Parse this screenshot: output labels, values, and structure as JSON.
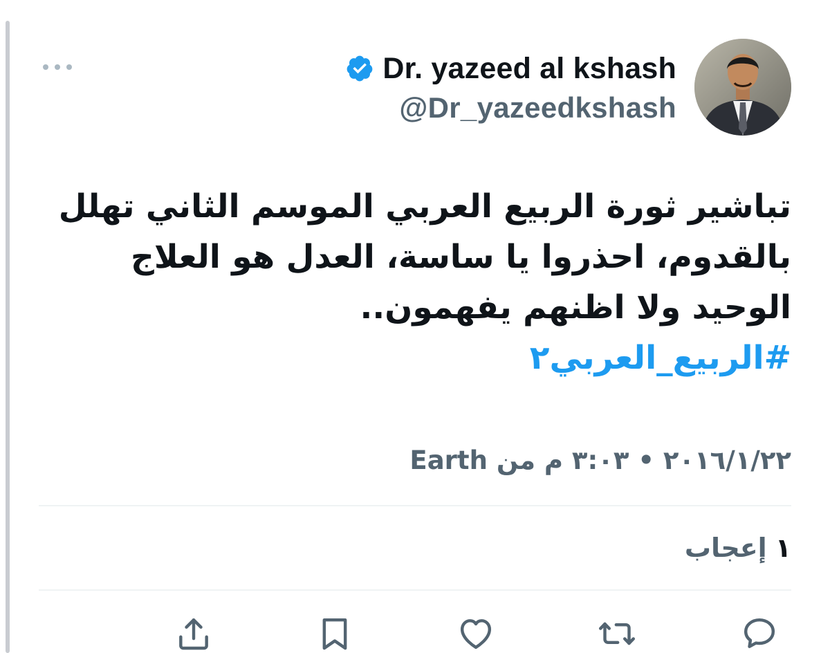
{
  "tweet": {
    "author": {
      "display_name": "Dr. yazeed al kshash",
      "handle": "@Dr_yazeedkshash",
      "verified": true
    },
    "text_lines": [
      "تباشير ثورة الربيع العربي الموسم الثاني تهلل",
      "بالقدوم، احذروا يا ساسة، العدل هو العلاج",
      "الوحيد ولا اظنهم يفهمون.."
    ],
    "hashtag": "#الربيع_العربي٢",
    "timestamp": "٢٠١٦/١/٢٢ • ٣:٠٣ م من Earth",
    "likes": {
      "count": "١",
      "label": "إعجاب"
    },
    "actions": [
      {
        "icon": "reply-icon"
      },
      {
        "icon": "retweet-icon"
      },
      {
        "icon": "like-icon"
      },
      {
        "icon": "bookmark-icon"
      },
      {
        "icon": "share-icon"
      }
    ]
  },
  "colors": {
    "text_primary": "#0f1419",
    "text_secondary": "#536471",
    "accent": "#1d9bf0",
    "divider": "#eff3f4"
  }
}
